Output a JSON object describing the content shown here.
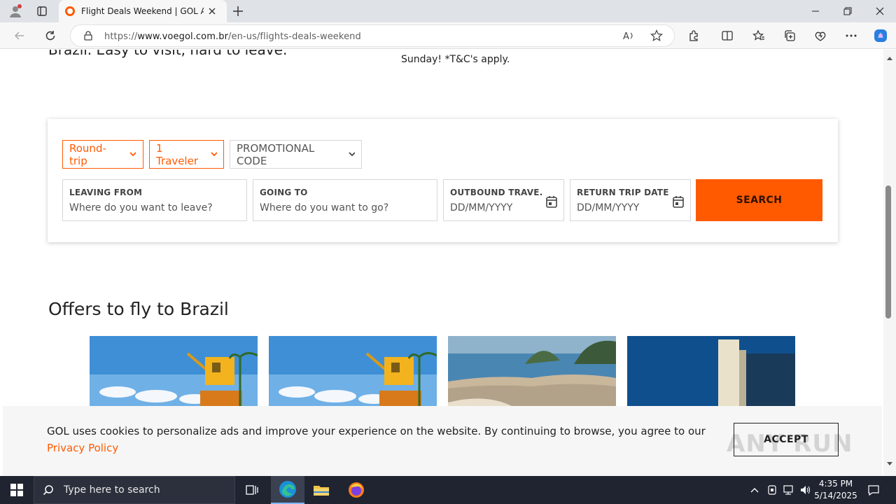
{
  "browser": {
    "tab_title": "Flight Deals Weekend | GOL Airlin",
    "url_prefix": "https://",
    "url_domain": "www.voegol.com.br",
    "url_path": "/en-us/flights-deals-weekend"
  },
  "page": {
    "hero_text": "Brazil. Easy to visit, hard to leave.",
    "hero_right": "Sunday! *T&C's apply.",
    "search": {
      "trip_type": "Round-trip",
      "travelers": "1 Traveler",
      "promo": "PROMOTIONAL CODE",
      "leaving_label": "LEAVING FROM",
      "leaving_placeholder": "Where do you want to leave?",
      "going_label": "GOING TO",
      "going_placeholder": "Where do you want to go?",
      "outbound_label": "OUTBOUND TRAVE...",
      "outbound_placeholder": "DD/MM/YYYY",
      "return_label": "RETURN TRIP DATE",
      "return_placeholder": "DD/MM/YYYY",
      "search_button": "SEARCH"
    },
    "offers_title": "Offers to fly to Brazil",
    "cookie": {
      "text": "GOL uses cookies to personalize ads and improve your experience on the website. By continuing to browse, you agree to our ",
      "link": "Privacy Policy",
      "accept": "ACCEPT",
      "watermark": "ANY RUN"
    }
  },
  "taskbar": {
    "search_placeholder": "Type here to search",
    "time": "4:35 PM",
    "date": "5/14/2025"
  },
  "colors": {
    "brand_orange": "#ff5a00",
    "taskbar": "#1f2430"
  }
}
